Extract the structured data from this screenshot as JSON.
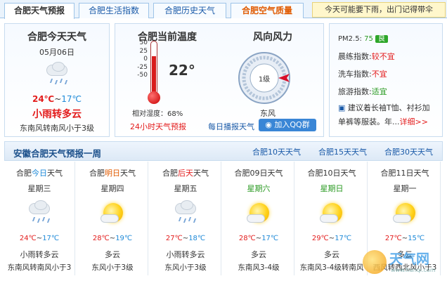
{
  "tabs": [
    {
      "label": "合肥天气预报"
    },
    {
      "label": "合肥生活指数"
    },
    {
      "label": "合肥历史天气"
    },
    {
      "label": "合肥空气质量"
    }
  ],
  "notice": "今天可能要下雨，出门记得带伞",
  "today": {
    "title": "合肥今天天气",
    "date": "05月06日",
    "temp_high": "24℃",
    "temp_sep": "~",
    "temp_low": "17℃",
    "desc": "小雨转多云",
    "wind": "东南风转南风小于3级"
  },
  "current": {
    "title": "合肥当前温度",
    "temp": "22°",
    "scale": [
      "50",
      "25",
      "0",
      "-25",
      "-50"
    ],
    "humidity_label": "相对湿度：",
    "humidity": "68%",
    "forecast_link": "24小时天气预报",
    "level": 0.72
  },
  "wind": {
    "title": "风向风力",
    "level": "1级",
    "direction": "东风",
    "broadcast_link": "每日播报天气",
    "qq_button": "加入QQ群"
  },
  "indices": {
    "pm_label": "PM2.5:",
    "pm_value": "75",
    "pm_grade": "良",
    "items": [
      {
        "label": "晨练指数:",
        "value": "较不宜"
      },
      {
        "label": "洗车指数:",
        "value": "不宜"
      },
      {
        "label": "旅游指数:",
        "value": "适宜"
      }
    ],
    "advice": "建议着长袖T恤、衬衫加单裤等服装。年...",
    "advice_line1": "建议着长袖T恤、衬衫加",
    "advice_line2": "单裤等服装。年...",
    "detail_link": "详细>>"
  },
  "week": {
    "title": "安徽合肥天气预报一周",
    "links": [
      "合肥10天天气",
      "合肥15天天气",
      "合肥30天天气"
    ],
    "days": [
      {
        "pre": "合肥",
        "hl": "今日",
        "post": "天气",
        "hl_color": "#1f8ad8",
        "weekday": "星期三",
        "weekday_color": "#333",
        "icon": "rain",
        "high": "24℃",
        "low": "17℃",
        "desc": "小雨转多云",
        "wind": "东南风转南风小于3"
      },
      {
        "pre": "合肥",
        "hl": "明日",
        "post": "天气",
        "hl_color": "#e05a00",
        "weekday": "星期四",
        "weekday_color": "#333",
        "icon": "sun",
        "high": "28℃",
        "low": "19℃",
        "desc": "多云",
        "wind": "东风小于3级"
      },
      {
        "pre": "合肥",
        "hl": "后天",
        "post": "天气",
        "hl_color": "#e31c1c",
        "weekday": "星期五",
        "weekday_color": "#333",
        "icon": "rain",
        "high": "27℃",
        "low": "18℃",
        "desc": "小雨转多云",
        "wind": "东风小于3级"
      },
      {
        "pre": "合肥",
        "hl": "09日",
        "post": "天气",
        "hl_color": "#333",
        "weekday": "星期六",
        "weekday_color": "#2a9a22",
        "icon": "sun",
        "high": "28℃",
        "low": "17℃",
        "desc": "多云",
        "wind": "东南风3-4级"
      },
      {
        "pre": "合肥",
        "hl": "10日",
        "post": "天气",
        "hl_color": "#333",
        "weekday": "星期日",
        "weekday_color": "#2a9a22",
        "icon": "sun",
        "high": "29℃",
        "low": "17℃",
        "desc": "多云",
        "wind": "东南风3-4级转南风"
      },
      {
        "pre": "合肥",
        "hl": "11日",
        "post": "天气",
        "hl_color": "#333",
        "weekday": "星期一",
        "weekday_color": "#333",
        "icon": "sun",
        "high": "27℃",
        "low": "15℃",
        "desc": "多云",
        "wind": "西风转西北风小于3"
      }
    ]
  },
  "watermark": {
    "text": "天气网",
    "sub": "www.tianqi.com"
  },
  "colors": {
    "accent": "#1a5aa8",
    "red": "#e31c1c",
    "blue": "#1f8ad8",
    "green": "#2a9a22",
    "border": "#c8dcef"
  }
}
